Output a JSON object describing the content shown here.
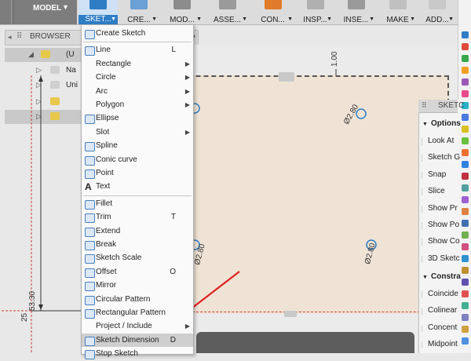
{
  "toolbar": {
    "model_label": "MODEL",
    "tools": [
      {
        "label": "SKETCH",
        "display": "SKET...",
        "active": true
      },
      {
        "label": "CREATE",
        "display": "CRE..."
      },
      {
        "label": "MODIFY",
        "display": "MOD..."
      },
      {
        "label": "ASSEMBLE",
        "display": "ASSE..."
      },
      {
        "label": "CONSTRUCT",
        "display": "CON..."
      },
      {
        "label": "INSPECT",
        "display": "INSP..."
      },
      {
        "label": "INSERT",
        "display": "INSE..."
      },
      {
        "label": "MAKE",
        "display": "MAKE"
      },
      {
        "label": "ADD-INS",
        "display": "ADD..."
      }
    ]
  },
  "browser": {
    "title": "BROWSER",
    "rows": [
      {
        "label": "(U"
      },
      {
        "label": "Na"
      },
      {
        "label": "Uni"
      },
      {
        "label": ""
      },
      {
        "label": ""
      }
    ]
  },
  "menu": {
    "items": [
      {
        "label": "Create Sketch",
        "shortcut": "",
        "submenu": false,
        "icon": "create-sketch-icon"
      },
      {
        "sep": true
      },
      {
        "label": "Line",
        "shortcut": "L",
        "submenu": false,
        "icon": "line-icon"
      },
      {
        "label": "Rectangle",
        "shortcut": "",
        "submenu": true,
        "icon": ""
      },
      {
        "label": "Circle",
        "shortcut": "",
        "submenu": true,
        "icon": ""
      },
      {
        "label": "Arc",
        "shortcut": "",
        "submenu": true,
        "icon": ""
      },
      {
        "label": "Polygon",
        "shortcut": "",
        "submenu": true,
        "icon": ""
      },
      {
        "label": "Ellipse",
        "shortcut": "",
        "submenu": false,
        "icon": "ellipse-icon"
      },
      {
        "label": "Slot",
        "shortcut": "",
        "submenu": true,
        "icon": ""
      },
      {
        "label": "Spline",
        "shortcut": "",
        "submenu": false,
        "icon": "spline-icon"
      },
      {
        "label": "Conic curve",
        "shortcut": "",
        "submenu": false,
        "icon": "conic-curve-icon"
      },
      {
        "label": "Point",
        "shortcut": "",
        "submenu": false,
        "icon": "point-icon"
      },
      {
        "label": "Text",
        "shortcut": "",
        "submenu": false,
        "icon": "text-icon"
      },
      {
        "sep": true
      },
      {
        "label": "Fillet",
        "shortcut": "",
        "submenu": false,
        "icon": "fillet-icon"
      },
      {
        "label": "Trim",
        "shortcut": "T",
        "submenu": false,
        "icon": "trim-icon"
      },
      {
        "label": "Extend",
        "shortcut": "",
        "submenu": false,
        "icon": "extend-icon"
      },
      {
        "label": "Break",
        "shortcut": "",
        "submenu": false,
        "icon": "break-icon"
      },
      {
        "label": "Sketch Scale",
        "shortcut": "",
        "submenu": false,
        "icon": "sketch-scale-icon"
      },
      {
        "label": "Offset",
        "shortcut": "O",
        "submenu": false,
        "icon": "offset-icon"
      },
      {
        "label": "Mirror",
        "shortcut": "",
        "submenu": false,
        "icon": "mirror-icon"
      },
      {
        "label": "Circular Pattern",
        "shortcut": "",
        "submenu": false,
        "icon": "circular-pattern-icon"
      },
      {
        "label": "Rectangular Pattern",
        "shortcut": "",
        "submenu": false,
        "icon": "rectangular-pattern-icon"
      },
      {
        "label": "Project / Include",
        "shortcut": "",
        "submenu": true,
        "icon": ""
      },
      {
        "label": "Sketch Dimension",
        "shortcut": "D",
        "submenu": false,
        "icon": "sketch-dimension-icon",
        "highlight": true
      },
      {
        "label": "Stop Sketch",
        "shortcut": "",
        "submenu": false,
        "icon": "stop-sketch-icon"
      }
    ]
  },
  "canvas": {
    "dimensions": [
      "1.00",
      "Ø2.80",
      "Ø2.80",
      "Ø2.80",
      "53.30",
      "25"
    ]
  },
  "palette": {
    "title": "SKETC",
    "section_options": "Options",
    "options": [
      "Look At",
      "Sketch G",
      "Snap",
      "Slice",
      "Show Pr",
      "Show Po",
      "Show Co",
      "3D Sketc"
    ],
    "section_constraints": "Constra",
    "constraints": [
      "Coincide",
      "Colinear",
      "Concent",
      "Midpoint"
    ]
  },
  "colors": {
    "accent": "#2f7dc5",
    "arrow": "#e02020",
    "sketch_plane": "#efe3d5"
  }
}
